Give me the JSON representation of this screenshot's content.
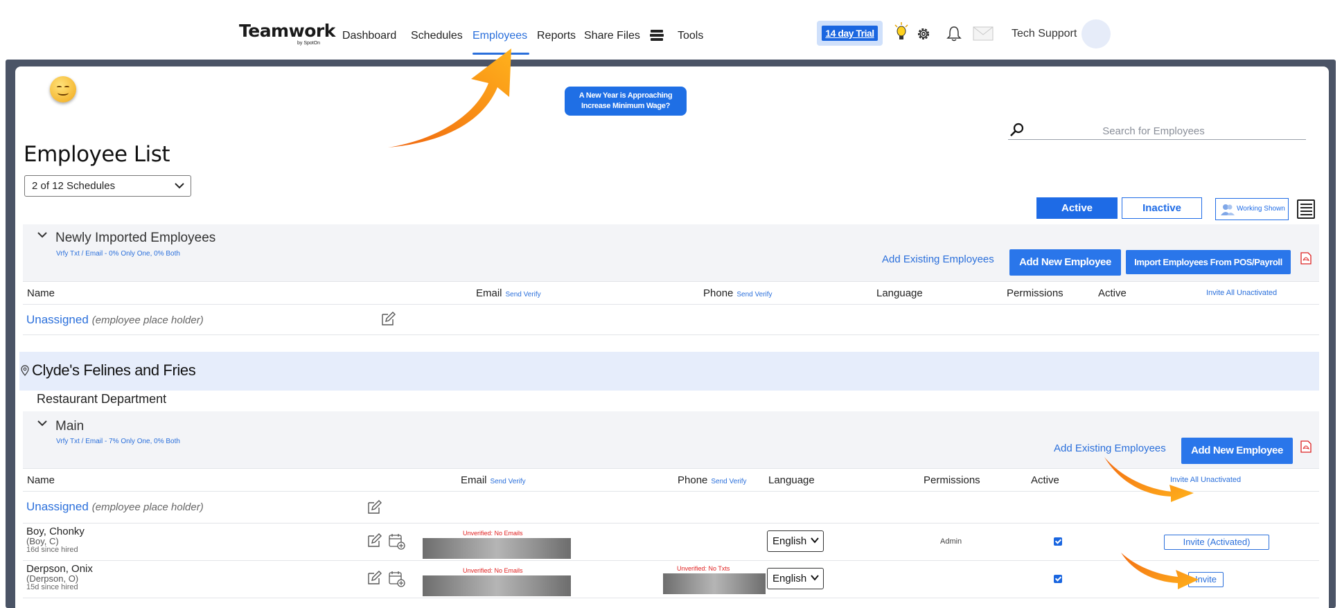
{
  "nav": {
    "logo": "Teamwork",
    "logo_by": "by SpotOn",
    "items": [
      "Dashboard",
      "Schedules",
      "Employees",
      "Reports",
      "Share Files",
      "Tools"
    ],
    "active": "Employees",
    "trial_label": "14 day Trial",
    "user_name": "Tech Support",
    "icons": [
      "stack-icon",
      "lightbulb-icon",
      "gear-icon",
      "bell-icon",
      "mail-icon"
    ]
  },
  "promo": {
    "line1": "A New Year is Approaching",
    "line2": "Increase Minimum Wage?"
  },
  "search": {
    "placeholder": "Search for Employees"
  },
  "page_title": "Employee List",
  "schedule_select": "2 of 12 Schedules",
  "filters": {
    "active": "Active",
    "inactive": "Inactive",
    "working": "Working Shown"
  },
  "newly_imported": {
    "title": "Newly Imported Employees",
    "subtitle": "Vrfy Txt / Email - 0% Only One, 0% Both",
    "add_existing": "Add Existing Employees",
    "add_new": "Add New Employee",
    "import_pos": "Import Employees From POS/Payroll"
  },
  "table_headers": {
    "name": "Name",
    "email": "Email",
    "phone": "Phone",
    "send_verify": "Send Verify",
    "language": "Language",
    "permissions": "Permissions",
    "active": "Active",
    "invite_all": "Invite All Unactivated"
  },
  "unassigned": {
    "name": "Unassigned",
    "note": "(employee place holder)"
  },
  "location": {
    "name": "Clyde's Felines and Fries"
  },
  "department": "Restaurant Department",
  "main_group": {
    "title": "Main",
    "subtitle": "Vrfy Txt / Email - 7% Only One, 0% Both",
    "add_existing": "Add Existing Employees",
    "add_new": "Add New Employee"
  },
  "employees": [
    {
      "name": "Boy, Chonky",
      "short": "(Boy, C)",
      "hired": "16d since hired",
      "email_status": "Unverified: No Emails",
      "phone_status": "",
      "language": "English",
      "permission": "Admin",
      "active": true,
      "invite_label": "Invite (Activated)"
    },
    {
      "name": "Derpson, Onix",
      "short": "(Derpson, O)",
      "hired": "15d since hired",
      "email_status": "Unverified: No Emails",
      "phone_status": "Unverified: No Txts",
      "language": "English",
      "permission": "",
      "active": true,
      "invite_label": "Invite"
    }
  ],
  "colors": {
    "accent": "#2a6fdb",
    "frame": "#4b5466",
    "arrow": "#f59b1b",
    "location_bg": "#e6edfb"
  }
}
